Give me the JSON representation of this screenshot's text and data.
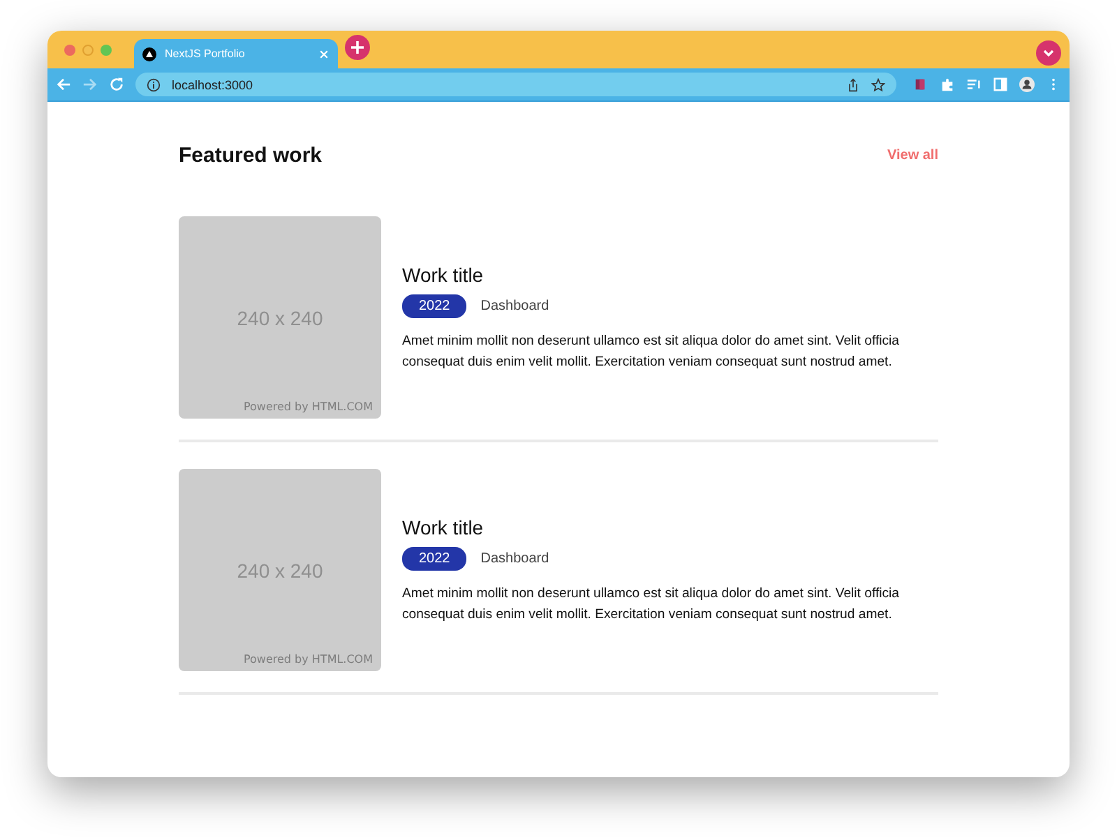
{
  "window": {
    "tab": {
      "title": "NextJS Portfolio",
      "selected": true
    },
    "url": "localhost:3000"
  },
  "section": {
    "title": "Featured work",
    "link": "View all"
  },
  "works": [
    {
      "image": {
        "size_text": "240 x 240",
        "credit": "Powered by HTML.COM"
      },
      "title": "Work title",
      "year": "2022",
      "category": "Dashboard",
      "description": "Amet minim mollit non deserunt ullamco est sit aliqua dolor do amet sint. Velit officia consequat duis enim velit mollit. Exercitation veniam consequat sunt nostrud amet."
    },
    {
      "image": {
        "size_text": "240 x 240",
        "credit": "Powered by HTML.COM"
      },
      "title": "Work title",
      "year": "2022",
      "category": "Dashboard",
      "description": "Amet minim mollit non deserunt ullamco est sit aliqua dolor do amet sint. Velit officia consequat duis enim velit mollit. Exercitation veniam consequat sunt nostrud amet."
    }
  ]
}
